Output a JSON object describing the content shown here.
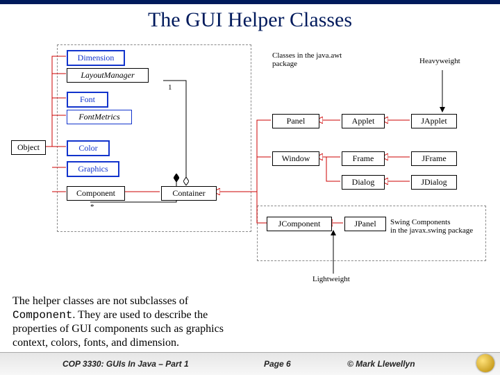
{
  "title": "The GUI Helper Classes",
  "nodes": {
    "object": "Object",
    "dimension": "Dimension",
    "layoutmanager": "LayoutManager",
    "font": "Font",
    "fontmetrics": "FontMetrics",
    "color": "Color",
    "graphics": "Graphics",
    "component": "Component",
    "container": "Container",
    "panel": "Panel",
    "applet": "Applet",
    "japplet": "JApplet",
    "window": "Window",
    "frame": "Frame",
    "jframe": "JFrame",
    "dialog": "Dialog",
    "jdialog": "JDialog",
    "jcomponent": "JComponent",
    "jpanel": "JPanel"
  },
  "labels": {
    "awt_group": "Classes in the java.awt\npackage",
    "heavyweight": "Heavyweight",
    "lightweight": "Lightweight",
    "swing_group": "Swing Components\nin the javax.swing package"
  },
  "multiplicity": {
    "one": "1",
    "star": "*"
  },
  "note": {
    "line1": "The helper classes are not subclasses of ",
    "mono": "Component",
    "line2": ". They are used to describe the properties of GUI components such as graphics context, colors, fonts, and dimension."
  },
  "footer": {
    "course": "COP 3330:  GUIs In Java – Part 1",
    "page": "Page 6",
    "copyright": "© Mark Llewellyn"
  }
}
